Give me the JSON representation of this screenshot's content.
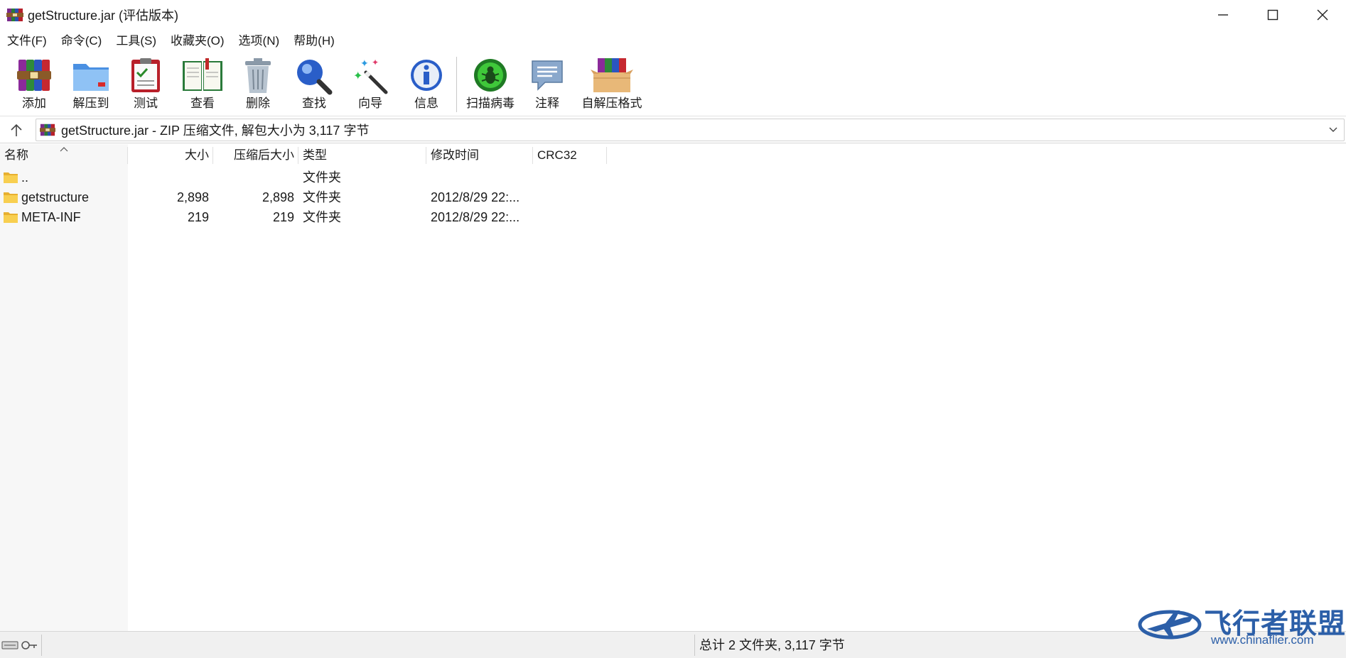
{
  "window": {
    "title": "getStructure.jar (评估版本)"
  },
  "menu": [
    "文件(F)",
    "命令(C)",
    "工具(S)",
    "收藏夹(O)",
    "选项(N)",
    "帮助(H)"
  ],
  "toolbar": {
    "buttons": [
      "添加",
      "解压到",
      "测试",
      "查看",
      "删除",
      "查找",
      "向导",
      "信息",
      "扫描病毒",
      "注释",
      "自解压格式"
    ]
  },
  "address": {
    "text": "getStructure.jar - ZIP 压缩文件, 解包大小为 3,117 字节"
  },
  "columns": [
    "名称",
    "大小",
    "压缩后大小",
    "类型",
    "修改时间",
    "CRC32"
  ],
  "rows": [
    {
      "name": "..",
      "size": "",
      "packed": "",
      "type": "文件夹",
      "modified": "",
      "crc": ""
    },
    {
      "name": "getstructure",
      "size": "2,898",
      "packed": "2,898",
      "type": "文件夹",
      "modified": "2012/8/29 22:...",
      "crc": ""
    },
    {
      "name": "META-INF",
      "size": "219",
      "packed": "219",
      "type": "文件夹",
      "modified": "2012/8/29 22:...",
      "crc": ""
    }
  ],
  "status": {
    "summary": "总计 2 文件夹, 3,117 字节"
  },
  "watermark": {
    "brand": "飞行者联盟",
    "url": "www.chinaflier.com"
  },
  "colors": {
    "accent": "#2c5fa8",
    "folder": "#f4c542"
  }
}
